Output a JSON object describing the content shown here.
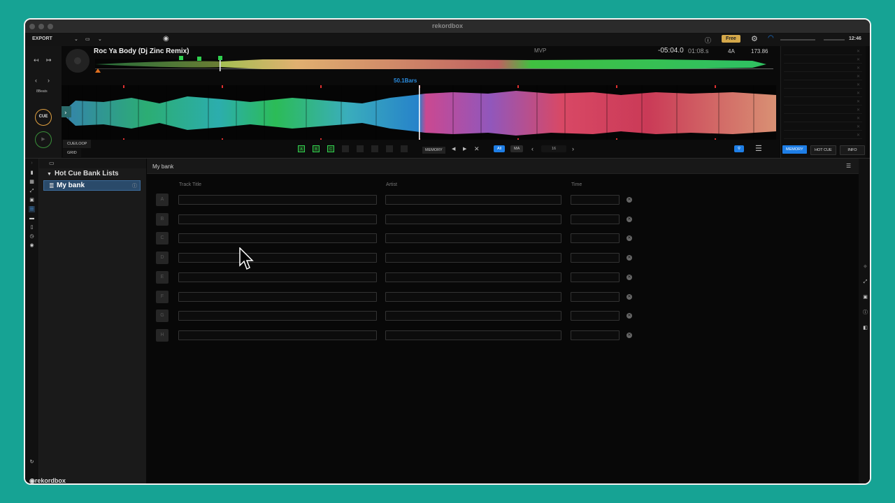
{
  "window": {
    "title": "rekordbox"
  },
  "menubar": {
    "export": "EXPORT",
    "free_badge": "Free",
    "clock": "12:46"
  },
  "deck": {
    "track_title": "Roc Ya Body (Dj Zinc Remix)",
    "mvp": "MVP",
    "time_remaining": "-05:04.0",
    "time_elapsed": "01:08.s",
    "key": "4A",
    "bpm": "173.86",
    "beats_label": "8Beats",
    "bars_label": "50.1Bars",
    "cue_label": "CUE",
    "cue_loop_tab": "CUE/LOOP",
    "grid_tab": "GRID",
    "hotcue_minis": [
      "A",
      "B",
      "C"
    ],
    "memory_label": "MEMORY",
    "all_label": "All",
    "ma_label": "MA",
    "page_number": "16"
  },
  "right_panel": {
    "tabs": [
      "MEMORY",
      "HOT CUE",
      "INFO"
    ]
  },
  "tree": {
    "root_label": "Hot Cue Bank Lists",
    "selected_label": "My bank"
  },
  "bank": {
    "title": "My bank",
    "columns": {
      "track_title": "Track Title",
      "artist": "Artist",
      "time": "Time"
    },
    "rows": [
      "A",
      "B",
      "C",
      "D",
      "E",
      "F",
      "G",
      "H"
    ]
  },
  "footer": {
    "logo_text": "rekordbox"
  },
  "colors": {
    "accent": "#1e7ee6",
    "cue_orange": "#e0a040",
    "teal_bg": "#16a394"
  }
}
